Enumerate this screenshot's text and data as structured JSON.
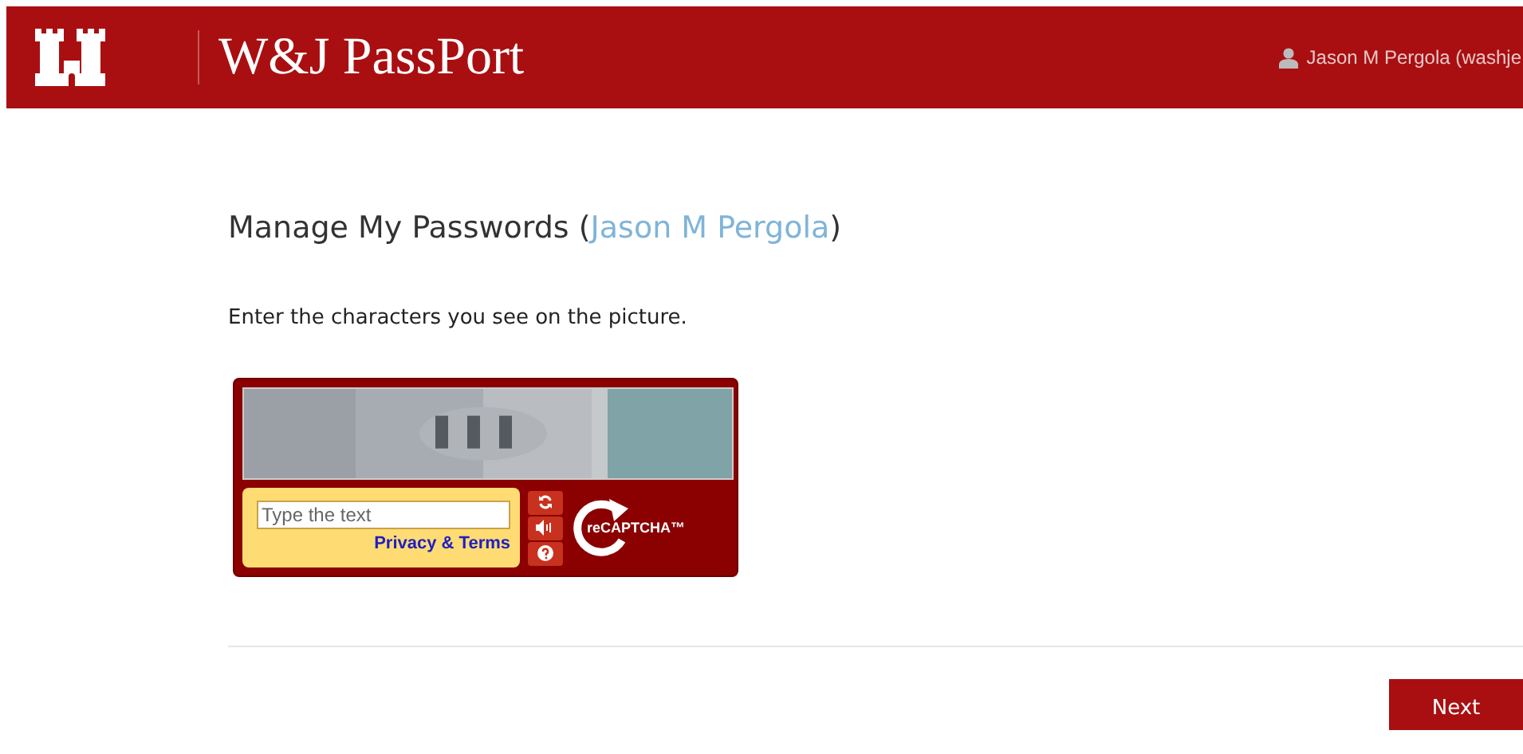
{
  "header": {
    "brand": "W&J PassPort",
    "user": "Jason M Pergola (washje"
  },
  "page": {
    "title": "Manage My Passwords (",
    "title_link": "Jason M Pergola",
    "title_end": ")",
    "instruction": "Enter the characters you see on the picture."
  },
  "captcha": {
    "placeholder": "Type the text",
    "privacy_link": "Privacy & Terms",
    "logo": "reCAPTCHA™"
  },
  "buttons": [
    {
      "label": "Next"
    }
  ]
}
